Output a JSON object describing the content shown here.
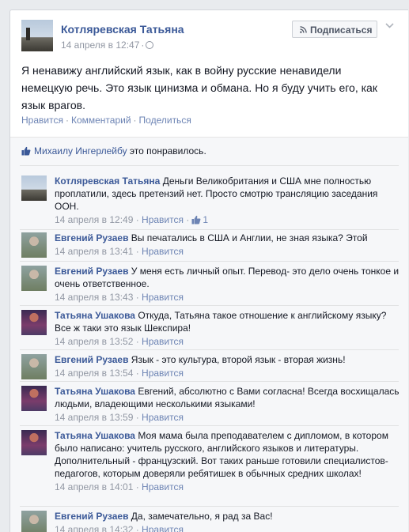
{
  "post": {
    "author": "Котляревская Татьяна",
    "date": "14 апреля в 12:47",
    "subscribe_label": "Подписаться",
    "text": "Я ненавижу английский язык, как в войну русские ненавидели немецкую речь. Это язык цинизма и обмана. Но я буду учить его, как язык врагов.",
    "actions": [
      "Нравится",
      "Комментарий",
      "Поделиться"
    ],
    "icons": {
      "privacy": "globe-icon",
      "subscribe": "rss-icon",
      "menu": "chevron-down-icon"
    }
  },
  "likes": {
    "name": "Михаилу Ингерлейбу",
    "suffix": "это понравилось."
  },
  "comments": [
    {
      "author": "Котляревская Татьяна",
      "text": "Деньги Великобритания и США мне полностью проплатили, здесь претензий нет. Просто смотрю трансляцию заседания ООН.",
      "time": "14 апреля в 12:49",
      "like_label": "Нравится",
      "likes_count": "1",
      "avatar": "kt"
    },
    {
      "author": "Евгений Рузаев",
      "text": "Вы печатались в США и Англии, не зная языка? Этой",
      "time": "14 апреля в 13:41",
      "like_label": "Нравится",
      "avatar": "er"
    },
    {
      "author": "Евгений Рузаев",
      "text": "У меня есть личный опыт. Перевод- это дело очень тонкое и очень ответственное.",
      "time": "14 апреля в 13:43",
      "like_label": "Нравится",
      "avatar": "er"
    },
    {
      "author": "Татьяна Ушакова",
      "text": "Откуда, Татьяна такое отношение к английскому языку? Все ж таки это язык Шекспира!",
      "time": "14 апреля в 13:52",
      "like_label": "Нравится",
      "avatar": "tu"
    },
    {
      "author": "Евгений Рузаев",
      "text": "Язык - это культура, второй язык - вторая жизнь!",
      "time": "14 апреля в 13:54",
      "like_label": "Нравится",
      "avatar": "er"
    },
    {
      "author": "Татьяна Ушакова",
      "text": "Евгений, абсолютно с Вами согласна! Всегда восхищалась людьми, владеющими несколькими языками!",
      "time": "14 апреля в 13:59",
      "like_label": "Нравится",
      "avatar": "tu"
    },
    {
      "author": "Татьяна Ушакова",
      "text": "Моя мама была преподавателем с дипломом, в котором было написано: учитель русского, английского языков и литературы. Дополнительный - французский. Вот таких раньше готовили специалистов- педагогов, которым доверяли ребятишек в обычных средних школах!",
      "time": "14 апреля в 14:01",
      "like_label": "Нравится",
      "avatar": "tu"
    },
    {
      "author": "Евгений Рузаев",
      "text": "Да, замечательно, я рад за Вас!",
      "time": "14 апреля в 14:32",
      "like_label": "Нравится",
      "avatar": "er"
    }
  ],
  "colors": {
    "link": "#3b5998",
    "muted": "#9197a3",
    "action": "#6d84b4",
    "feedback_bg": "#f6f7f9"
  }
}
